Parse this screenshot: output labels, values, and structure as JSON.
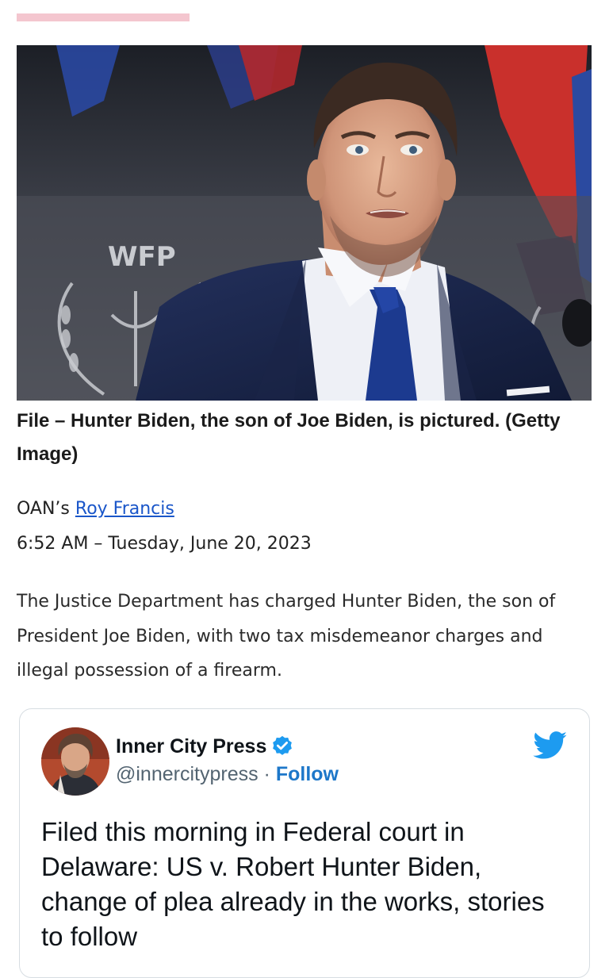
{
  "article": {
    "image_caption": "File – Hunter Biden, the son of Joe Biden, is pictured. (Getty Image)",
    "photo_watermark_text": "WFP",
    "byline_prefix": "OAN’s ",
    "author_name": "Roy Francis",
    "dateline": "6:52 AM – Tuesday, June 20, 2023",
    "lede": "The Justice Department has charged Hunter Biden, the son of President Joe Biden, with two tax misdemeanor charges and illegal possession of a firearm."
  },
  "embedded_tweet": {
    "display_name": "Inner City Press",
    "handle": "@innercitypress",
    "separator": " · ",
    "follow_label": "Follow",
    "text": "Filed this morning in Federal court in Delaware: US v. Robert Hunter Biden, change of plea already in the works, stories to follow",
    "icons": {
      "verified": "verified-badge-icon",
      "platform": "twitter-bird-icon"
    }
  },
  "colors": {
    "accent_bar": "#f4c6cf",
    "link": "#1a56c9",
    "twitter_blue": "#1d9bf0",
    "follow": "#1d77c9"
  }
}
